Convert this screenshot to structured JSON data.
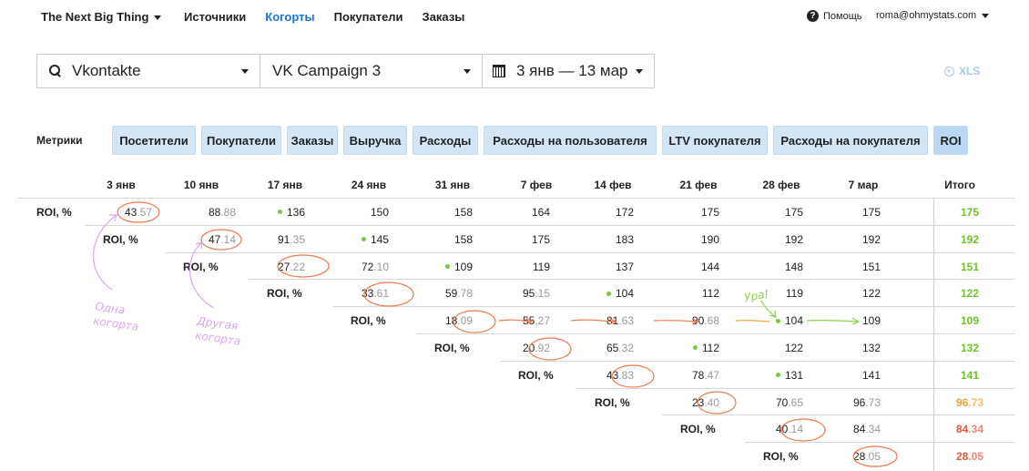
{
  "nav": {
    "brand": "The Next Big Thing",
    "links": [
      "Источники",
      "Когорты",
      "Покупатели",
      "Заказы"
    ],
    "active": 1,
    "help": "Помощь",
    "user": "roma@ohmystats.com"
  },
  "filters": {
    "source": "Vkontakte",
    "campaign": "VK Campaign 3",
    "dates": "3 янв — 13 мар",
    "export": "XLS"
  },
  "metrics": {
    "label": "Метрики",
    "tabs": [
      "Посетители",
      "Покупатели",
      "Заказы",
      "Выручка",
      "Расходы",
      "Расходы на пользователя",
      "LTV покупателя",
      "Расходы на покупателя",
      "ROI"
    ],
    "active": 8
  },
  "table": {
    "columns": [
      "3 янв",
      "10 янв",
      "17 янв",
      "24 янв",
      "31 янв",
      "7 фев",
      "14 фев",
      "21 фев",
      "28 фев",
      "7 мар"
    ],
    "total_header": "Итого",
    "row_label": "ROI, %",
    "rows": [
      {
        "cells": [
          {
            "i": "43",
            "d": ".57"
          },
          {
            "i": "88",
            "d": ".88"
          },
          {
            "i": "136",
            "dot": true
          },
          {
            "i": "150"
          },
          {
            "i": "158"
          },
          {
            "i": "164"
          },
          {
            "i": "172"
          },
          {
            "i": "175"
          },
          {
            "i": "175"
          },
          {
            "i": "175"
          }
        ],
        "total": {
          "i": "175",
          "d": "",
          "color": "#6fc22b"
        }
      },
      {
        "cells": [
          {
            "i": "47",
            "d": ".14"
          },
          {
            "i": "91",
            "d": ".35"
          },
          {
            "i": "145",
            "dot": true
          },
          {
            "i": "158"
          },
          {
            "i": "175"
          },
          {
            "i": "183"
          },
          {
            "i": "190"
          },
          {
            "i": "192"
          },
          {
            "i": "192"
          }
        ],
        "total": {
          "i": "192",
          "d": "",
          "color": "#6fc22b"
        }
      },
      {
        "cells": [
          {
            "i": "27",
            "d": ".22"
          },
          {
            "i": "72",
            "d": ".10"
          },
          {
            "i": "109",
            "dot": true
          },
          {
            "i": "119"
          },
          {
            "i": "137"
          },
          {
            "i": "144"
          },
          {
            "i": "148"
          },
          {
            "i": "151"
          }
        ],
        "total": {
          "i": "151",
          "d": "",
          "color": "#6fc22b"
        }
      },
      {
        "cells": [
          {
            "i": "33",
            "d": ".61"
          },
          {
            "i": "59",
            "d": ".78"
          },
          {
            "i": "95",
            "d": ".15"
          },
          {
            "i": "104",
            "dot": true
          },
          {
            "i": "112"
          },
          {
            "i": "119"
          },
          {
            "i": "122"
          }
        ],
        "total": {
          "i": "122",
          "d": "",
          "color": "#6fc22b"
        }
      },
      {
        "cells": [
          {
            "i": "18",
            "d": ".09"
          },
          {
            "i": "55",
            "d": ".27"
          },
          {
            "i": "81",
            "d": ".63"
          },
          {
            "i": "90",
            "d": ".68"
          },
          {
            "i": "104",
            "dot": true
          },
          {
            "i": "109"
          }
        ],
        "total": {
          "i": "109",
          "d": "",
          "color": "#6fc22b"
        }
      },
      {
        "cells": [
          {
            "i": "20",
            "d": ".92"
          },
          {
            "i": "65",
            "d": ".32"
          },
          {
            "i": "112",
            "dot": true
          },
          {
            "i": "122"
          },
          {
            "i": "132"
          }
        ],
        "total": {
          "i": "132",
          "d": "",
          "color": "#6fc22b"
        }
      },
      {
        "cells": [
          {
            "i": "43",
            "d": ".83"
          },
          {
            "i": "78",
            "d": ".47"
          },
          {
            "i": "131",
            "dot": true
          },
          {
            "i": "141"
          }
        ],
        "total": {
          "i": "141",
          "d": "",
          "color": "#6fc22b"
        }
      },
      {
        "cells": [
          {
            "i": "23",
            "d": ".40"
          },
          {
            "i": "70",
            "d": ".65"
          },
          {
            "i": "96",
            "d": ".73"
          }
        ],
        "total": {
          "i": "96",
          "d": ".73",
          "color": "#f0a030"
        }
      },
      {
        "cells": [
          {
            "i": "40",
            "d": ".14"
          },
          {
            "i": "84",
            "d": ".34"
          }
        ],
        "total": {
          "i": "84",
          "d": ".34",
          "color": "#e8563a"
        }
      },
      {
        "cells": [
          {
            "i": "28",
            "d": ".05"
          }
        ],
        "total": {
          "i": "28",
          "d": ".05",
          "color": "#e8563a"
        }
      }
    ]
  },
  "annotations": {
    "note1": [
      "Одна",
      "когорта"
    ],
    "note2": [
      "Другая",
      "когорта"
    ],
    "note3": "Ура!",
    "colors": {
      "purple": "#d9a6f2",
      "orange": "#f07a4e",
      "green": "#8cd24a"
    }
  }
}
